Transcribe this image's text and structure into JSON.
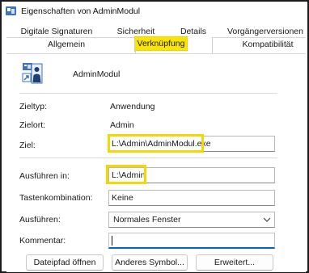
{
  "window": {
    "title": "Eigenschaften von AdminModul",
    "icon": "shortcut-properties-icon"
  },
  "tabs": {
    "row1": [
      "Digitale Signaturen",
      "Sicherheit",
      "Details",
      "Vorgängerversionen"
    ],
    "row2": [
      "Allgemein",
      "Verknüpfung",
      "Kompatibilität"
    ],
    "active": "Verknüpfung"
  },
  "shortcut": {
    "icon": "application-admin-icon",
    "name": "AdminModul"
  },
  "fields": {
    "zieltyp_label": "Zieltyp:",
    "zieltyp_value": "Anwendung",
    "zielort_label": "Zielort:",
    "zielort_value": "Admin",
    "ziel_label": "Ziel:",
    "ziel_value": "L:\\Admin\\AdminModul.exe",
    "ausfuehren_in_label": "Ausführen in:",
    "ausfuehren_in_value": "L:\\Admin",
    "tastenkombination_label": "Tastenkombination:",
    "tastenkombination_value": "Keine",
    "ausfuehren_label": "Ausführen:",
    "ausfuehren_value": "Normales Fenster",
    "kommentar_label": "Kommentar:",
    "kommentar_value": ""
  },
  "buttons": {
    "dateipfad": "Dateipfad öffnen",
    "anderes_symbol": "Anderes Symbol...",
    "erweitert": "Erweitert..."
  },
  "colors": {
    "highlight": "#f5d800",
    "focus_underline": "#0067c0",
    "icon_blue": "#3b73c2"
  }
}
